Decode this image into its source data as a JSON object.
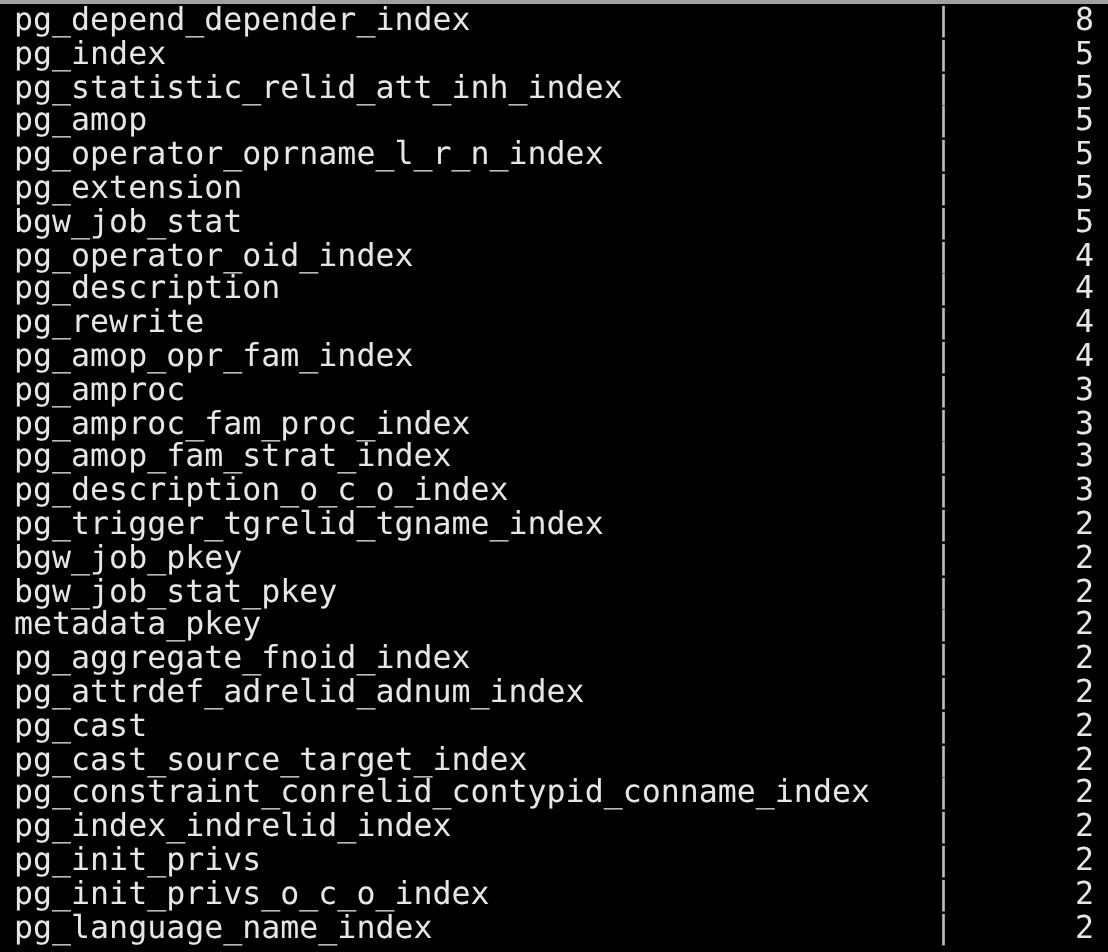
{
  "rows": [
    {
      "name": "pg_depend_depender_index",
      "sep": "|",
      "count": "8"
    },
    {
      "name": "pg_index",
      "sep": "|",
      "count": "5"
    },
    {
      "name": "pg_statistic_relid_att_inh_index",
      "sep": "|",
      "count": "5"
    },
    {
      "name": "pg_amop",
      "sep": "|",
      "count": "5"
    },
    {
      "name": "pg_operator_oprname_l_r_n_index",
      "sep": "|",
      "count": "5"
    },
    {
      "name": "pg_extension",
      "sep": "|",
      "count": "5"
    },
    {
      "name": "bgw_job_stat",
      "sep": "|",
      "count": "5"
    },
    {
      "name": "pg_operator_oid_index",
      "sep": "|",
      "count": "4"
    },
    {
      "name": "pg_description",
      "sep": "|",
      "count": "4"
    },
    {
      "name": "pg_rewrite",
      "sep": "|",
      "count": "4"
    },
    {
      "name": "pg_amop_opr_fam_index",
      "sep": "|",
      "count": "4"
    },
    {
      "name": "pg_amproc",
      "sep": "|",
      "count": "3"
    },
    {
      "name": "pg_amproc_fam_proc_index",
      "sep": "|",
      "count": "3"
    },
    {
      "name": "pg_amop_fam_strat_index",
      "sep": "|",
      "count": "3"
    },
    {
      "name": "pg_description_o_c_o_index",
      "sep": "|",
      "count": "3"
    },
    {
      "name": "pg_trigger_tgrelid_tgname_index",
      "sep": "|",
      "count": "2"
    },
    {
      "name": "bgw_job_pkey",
      "sep": "|",
      "count": "2"
    },
    {
      "name": "bgw_job_stat_pkey",
      "sep": "|",
      "count": "2"
    },
    {
      "name": "metadata_pkey",
      "sep": "|",
      "count": "2"
    },
    {
      "name": "pg_aggregate_fnoid_index",
      "sep": "|",
      "count": "2"
    },
    {
      "name": "pg_attrdef_adrelid_adnum_index",
      "sep": "|",
      "count": "2"
    },
    {
      "name": "pg_cast",
      "sep": "|",
      "count": "2"
    },
    {
      "name": "pg_cast_source_target_index",
      "sep": "|",
      "count": "2"
    },
    {
      "name": "pg_constraint_conrelid_contypid_conname_index",
      "sep": "|",
      "count": "2"
    },
    {
      "name": "pg_index_indrelid_index",
      "sep": "|",
      "count": "2"
    },
    {
      "name": "pg_init_privs",
      "sep": "|",
      "count": "2"
    },
    {
      "name": "pg_init_privs_o_c_o_index",
      "sep": "|",
      "count": "2"
    },
    {
      "name": "pg_language_name_index",
      "sep": "|",
      "count": "2"
    }
  ]
}
